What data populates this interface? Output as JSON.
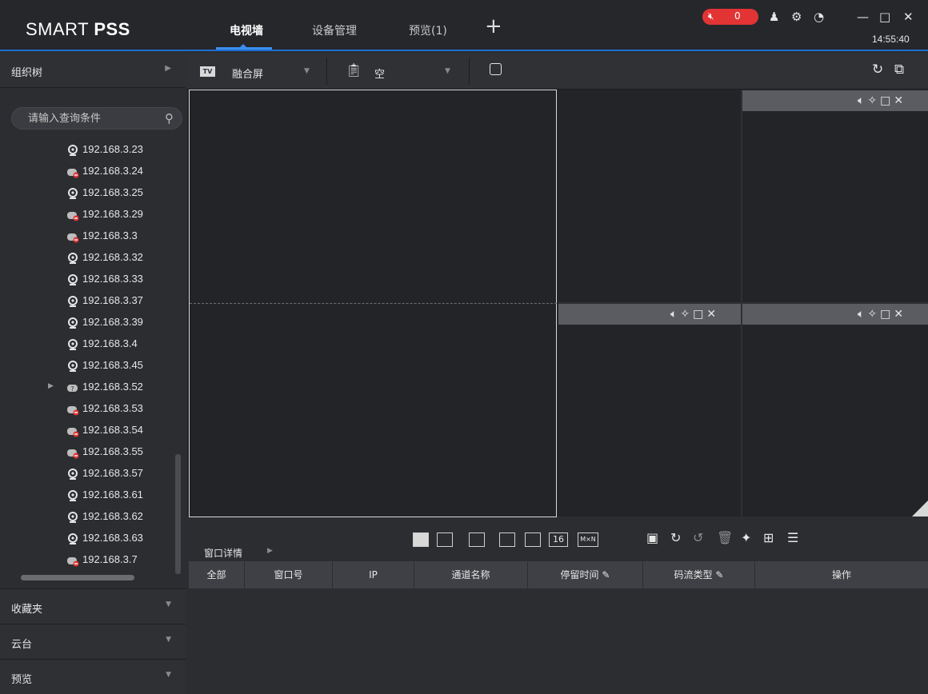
{
  "app": {
    "logo": "SMART PSS",
    "tabs": [
      {
        "label": "电视墙",
        "active": true
      },
      {
        "label": "设备管理",
        "active": false
      },
      {
        "label": "预览(1)",
        "active": false
      }
    ],
    "add_tab": "+",
    "alarm_count": "0",
    "clock": "14:55:40"
  },
  "sidebar": {
    "org_tree": "组织树",
    "search_placeholder": "请输入查询条件",
    "devices": [
      {
        "ip": "192.168.3.23",
        "status": "online"
      },
      {
        "ip": "192.168.3.24",
        "status": "offline"
      },
      {
        "ip": "192.168.3.25",
        "status": "online"
      },
      {
        "ip": "192.168.3.29",
        "status": "offline"
      },
      {
        "ip": "192.168.3.3",
        "status": "offline"
      },
      {
        "ip": "192.168.3.32",
        "status": "online"
      },
      {
        "ip": "192.168.3.33",
        "status": "online"
      },
      {
        "ip": "192.168.3.37",
        "status": "online"
      },
      {
        "ip": "192.168.3.39",
        "status": "online"
      },
      {
        "ip": "192.168.3.4",
        "status": "online"
      },
      {
        "ip": "192.168.3.45",
        "status": "online"
      },
      {
        "ip": "192.168.3.52",
        "status": "unknown"
      },
      {
        "ip": "192.168.3.53",
        "status": "offline"
      },
      {
        "ip": "192.168.3.54",
        "status": "offline"
      },
      {
        "ip": "192.168.3.55",
        "status": "offline"
      },
      {
        "ip": "192.168.3.57",
        "status": "online"
      },
      {
        "ip": "192.168.3.61",
        "status": "online"
      },
      {
        "ip": "192.168.3.62",
        "status": "online"
      },
      {
        "ip": "192.168.3.63",
        "status": "online"
      },
      {
        "ip": "192.168.3.7",
        "status": "offline"
      }
    ],
    "sections": [
      "收藏夹",
      "云台",
      "预览"
    ]
  },
  "toolbar": {
    "tv_badge": "TV",
    "wall_mode": "融合屏",
    "plan_name": "空"
  },
  "detail": {
    "tab_label": "窗口详情",
    "columns": [
      "全部",
      "窗口号",
      "IP",
      "通道名称",
      "停留时间",
      "码流类型",
      "操作"
    ],
    "split_16": "16",
    "split_mn": "M×N"
  },
  "colors": {
    "accent": "#3b8ef0",
    "alarm": "#e23434",
    "background": "#2b2d31"
  }
}
